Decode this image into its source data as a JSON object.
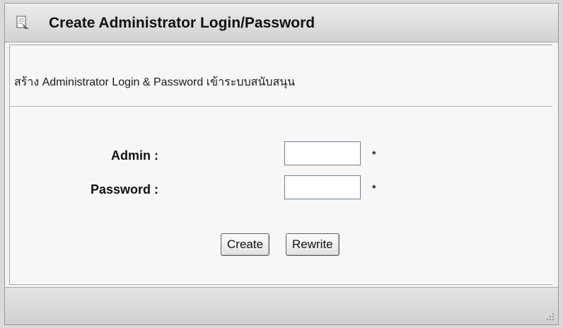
{
  "window": {
    "title": "Create Administrator Login/Password",
    "icon": "document-icon"
  },
  "content": {
    "description": "สร้าง Administrator Login & Password เข้าระบบสนับสนุน",
    "admin_label": "Admin :",
    "admin_value": "",
    "admin_required": "*",
    "password_label": "Password :",
    "password_value": "",
    "password_required": "*",
    "create_button": "Create",
    "rewrite_button": "Rewrite"
  },
  "statusbar": {
    "grip_icon": "resize-grip-icon"
  }
}
